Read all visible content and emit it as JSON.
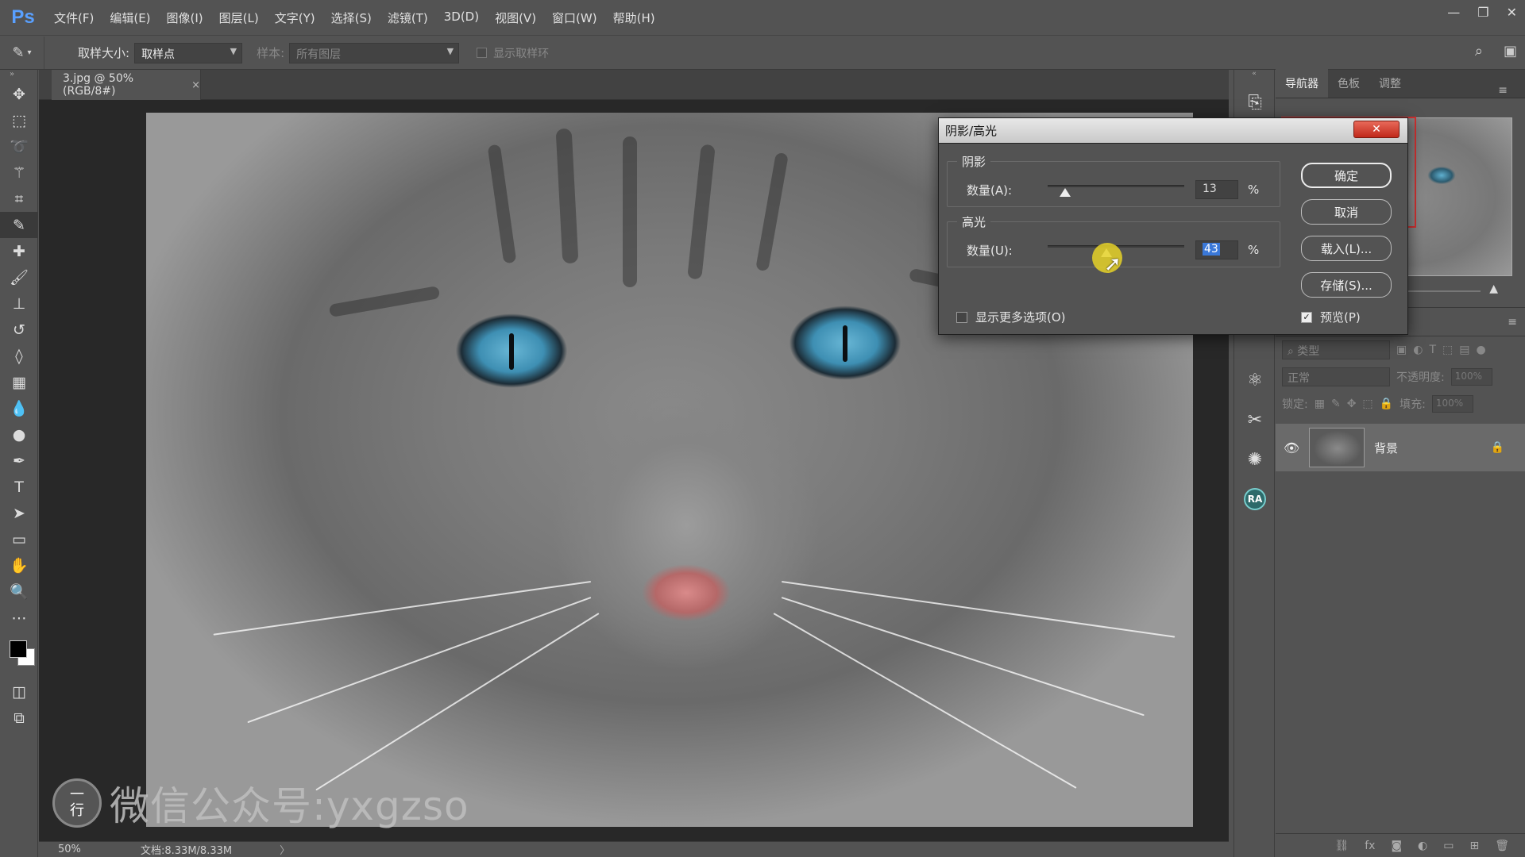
{
  "app": {
    "logo": "Ps"
  },
  "menu": [
    "文件(F)",
    "编辑(E)",
    "图像(I)",
    "图层(L)",
    "文字(Y)",
    "选择(S)",
    "滤镜(T)",
    "3D(D)",
    "视图(V)",
    "窗口(W)",
    "帮助(H)"
  ],
  "window_controls": {
    "minimize": "—",
    "restore": "❐",
    "close": "✕"
  },
  "options": {
    "sample_size_label": "取样大小:",
    "sample_size_value": "取样点",
    "sample_label": "样本:",
    "sample_value": "所有图层",
    "show_ring_label": "显示取样环"
  },
  "document": {
    "tab_label": "3.jpg @ 50%(RGB/8#)",
    "close": "×"
  },
  "status": {
    "zoom": "50%",
    "doc_info": "文档:8.33M/8.33M",
    "arrow": "〉"
  },
  "watermark": {
    "seal": "一\n行",
    "text": "微信公众号:yxgzso"
  },
  "nav_panel": {
    "tabs": [
      "导航器",
      "色板",
      "调整"
    ],
    "active_tab": 0
  },
  "layers_panel": {
    "filter_label": "类型",
    "blend_mode": "正常",
    "opacity_label": "不透明度:",
    "opacity_value": "100%",
    "lock_label": "锁定:",
    "fill_label": "填充:",
    "fill_value": "100%",
    "layer_name": "背景",
    "bottom_icons": [
      "⛓",
      "fx",
      "◙",
      "◐",
      "▭",
      "⊞",
      "🗑"
    ]
  },
  "dialog": {
    "title": "阴影/高光",
    "close": "✕",
    "shadows": {
      "legend": "阴影",
      "label": "数量(A):",
      "value": "13",
      "fraction": 0.13,
      "unit": "%"
    },
    "highlights": {
      "legend": "高光",
      "label": "数量(U):",
      "value": "43",
      "fraction": 0.43,
      "unit": "%"
    },
    "buttons": {
      "ok": "确定",
      "cancel": "取消",
      "load": "载入(L)...",
      "save": "存储(S)..."
    },
    "more_options": {
      "label": "显示更多选项(O)",
      "checked": false
    },
    "preview": {
      "label": "预览(P)",
      "checked": true
    }
  },
  "icons": {
    "tools": [
      "move-icon",
      "marquee-icon",
      "lasso-icon",
      "magic-wand-icon",
      "crop-icon",
      "eyedropper-icon",
      "healing-brush-icon",
      "brush-icon",
      "stamp-icon",
      "history-brush-icon",
      "eraser-icon",
      "gradient-icon",
      "blur-icon",
      "dodge-icon",
      "pen-icon",
      "type-icon",
      "path-select-icon",
      "rectangle-icon",
      "hand-icon",
      "zoom-icon",
      "more-icon"
    ]
  }
}
